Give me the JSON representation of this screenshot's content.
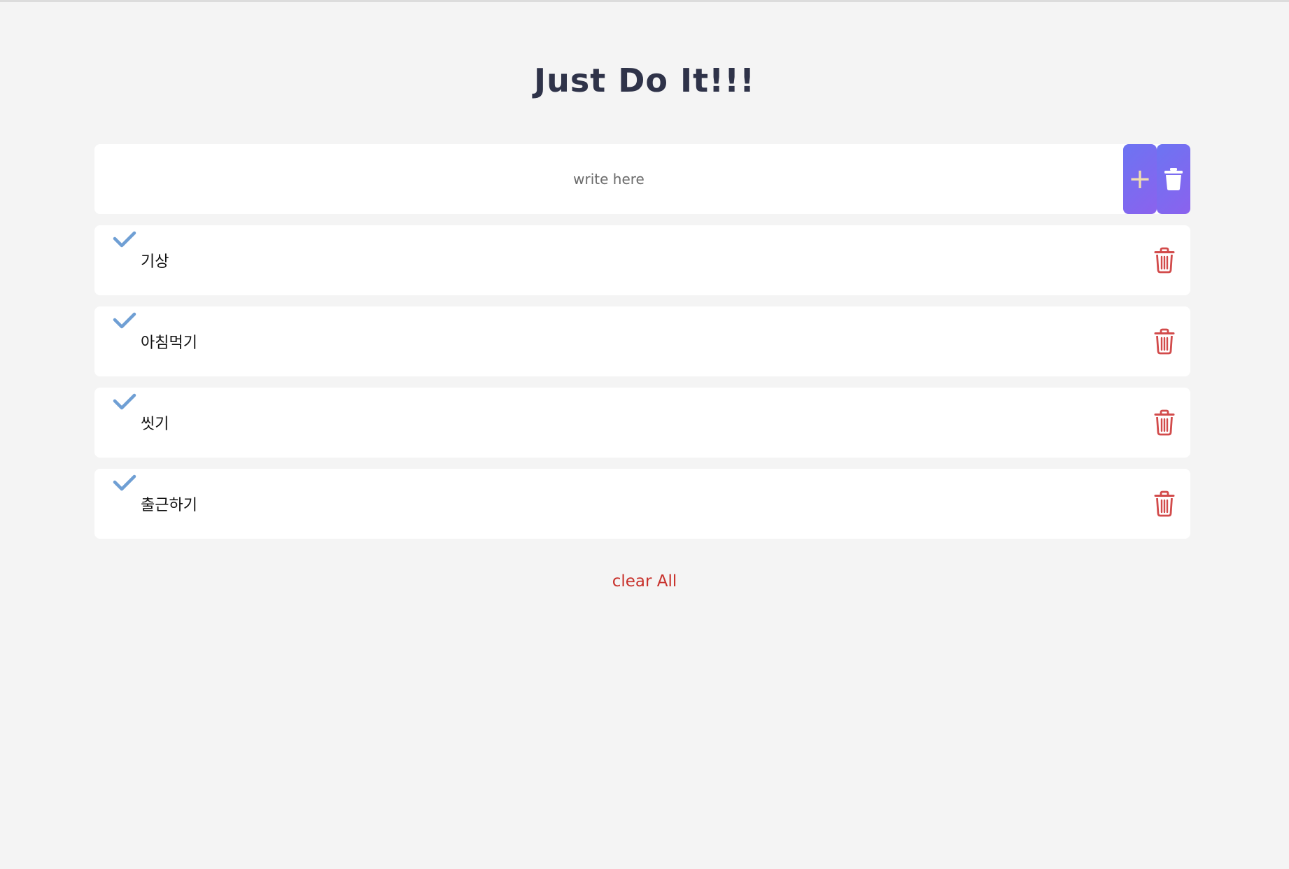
{
  "header": {
    "title": "Just Do It!!!"
  },
  "input": {
    "placeholder": "write here",
    "value": "",
    "add_icon": "plus-icon",
    "delete_all_icon": "trash-icon"
  },
  "todos": [
    {
      "text": "기상",
      "done_icon": "check-icon",
      "remove_icon": "trash-icon"
    },
    {
      "text": "아침먹기",
      "done_icon": "check-icon",
      "remove_icon": "trash-icon"
    },
    {
      "text": "씻기",
      "done_icon": "check-icon",
      "remove_icon": "trash-icon"
    },
    {
      "text": "출근하기",
      "done_icon": "check-icon",
      "remove_icon": "trash-icon"
    }
  ],
  "footer": {
    "clear_all_label": "clear All"
  },
  "colors": {
    "background": "#f4f4f4",
    "accent_gradient_start": "#6c74f2",
    "accent_gradient_end": "#8b62ee",
    "check": "#6f9fd4",
    "trash": "#d24b4b",
    "clear_all": "#c8312b",
    "title": "#2f3349"
  }
}
